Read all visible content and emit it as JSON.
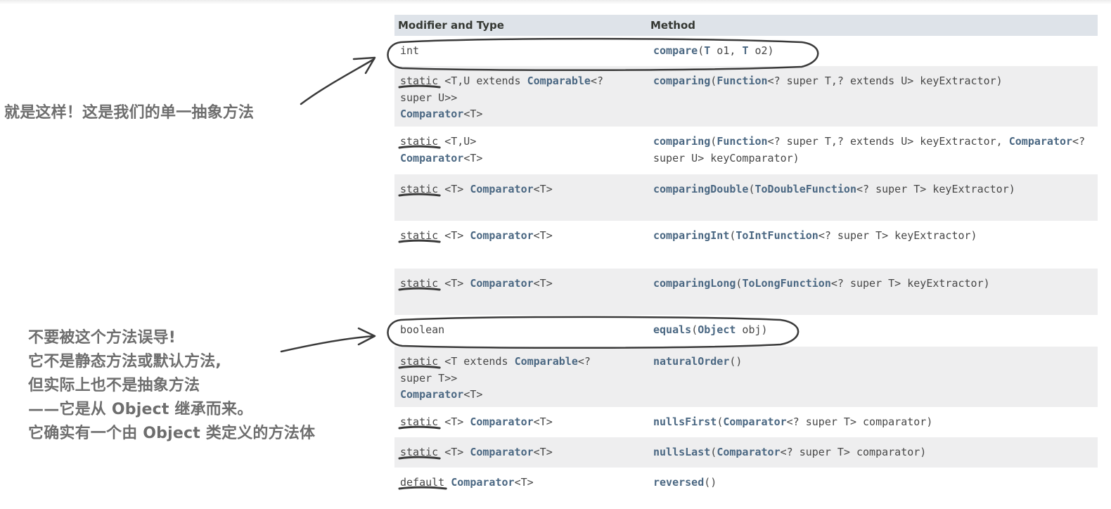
{
  "annotations": {
    "top_note": "就是这样！这是我们的单一抽象方法",
    "bottom_note_lines": [
      "不要被这个方法误导!",
      "它不是静态方法或默认方法,",
      "但实际上也不是抽象方法",
      "——它是从 Object 继承而来。",
      "它确实有一个由 Object 类定义的方法体"
    ]
  },
  "table": {
    "header": {
      "col1": "Modifier and Type",
      "col2": "Method"
    },
    "rows": [
      {
        "mod_lines": [
          [
            [
              "int",
              "t"
            ]
          ]
        ],
        "method_lines": [
          [
            [
              "compare",
              "m"
            ],
            [
              "(",
              "t"
            ],
            [
              "T",
              "l"
            ],
            [
              " o1, ",
              "t"
            ],
            [
              "T",
              "l"
            ],
            [
              " o2)",
              "t"
            ]
          ]
        ]
      },
      {
        "mod_lines": [
          [
            [
              "static",
              "t"
            ],
            [
              " <T,U extends ",
              "t"
            ],
            [
              "Comparable",
              "l"
            ],
            [
              "<?",
              "t"
            ]
          ],
          [
            [
              "super U>>",
              "t"
            ]
          ],
          [
            [
              "Comparator",
              "l"
            ],
            [
              "<T>",
              "t"
            ]
          ]
        ],
        "method_lines": [
          [
            [
              "comparing",
              "m"
            ],
            [
              "(",
              "t"
            ],
            [
              "Function",
              "l"
            ],
            [
              "<? super T,? extends U> keyExtractor)",
              "t"
            ]
          ]
        ]
      },
      {
        "mod_lines": [
          [
            [
              "static",
              "t"
            ],
            [
              " <T,U>",
              "t"
            ]
          ],
          [
            [
              "Comparator",
              "l"
            ],
            [
              "<T>",
              "t"
            ]
          ]
        ],
        "method_lines": [
          [
            [
              "comparing",
              "m"
            ],
            [
              "(",
              "t"
            ],
            [
              "Function",
              "l"
            ],
            [
              "<? super T,? extends U> keyExtractor, ",
              "t"
            ],
            [
              "Comparator",
              "l"
            ],
            [
              "<?",
              "t"
            ]
          ],
          [
            [
              "super U> keyComparator)",
              "t"
            ]
          ]
        ]
      },
      {
        "mod_lines": [
          [
            [
              "static",
              "t"
            ],
            [
              " <T> ",
              "t"
            ],
            [
              "Comparator",
              "l"
            ],
            [
              "<T>",
              "t"
            ]
          ]
        ],
        "method_lines": [
          [
            [
              "comparingDouble",
              "m"
            ],
            [
              "(",
              "t"
            ],
            [
              "ToDoubleFunction",
              "l"
            ],
            [
              "<? super T> keyExtractor)",
              "t"
            ]
          ]
        ]
      },
      {
        "mod_lines": [
          [
            [
              "static",
              "t"
            ],
            [
              " <T> ",
              "t"
            ],
            [
              "Comparator",
              "l"
            ],
            [
              "<T>",
              "t"
            ]
          ]
        ],
        "method_lines": [
          [
            [
              "comparingInt",
              "m"
            ],
            [
              "(",
              "t"
            ],
            [
              "ToIntFunction",
              "l"
            ],
            [
              "<? super T> keyExtractor)",
              "t"
            ]
          ]
        ]
      },
      {
        "mod_lines": [
          [
            [
              "static",
              "t"
            ],
            [
              " <T> ",
              "t"
            ],
            [
              "Comparator",
              "l"
            ],
            [
              "<T>",
              "t"
            ]
          ]
        ],
        "method_lines": [
          [
            [
              "comparingLong",
              "m"
            ],
            [
              "(",
              "t"
            ],
            [
              "ToLongFunction",
              "l"
            ],
            [
              "<? super T> keyExtractor)",
              "t"
            ]
          ]
        ]
      },
      {
        "mod_lines": [
          [
            [
              "boolean",
              "t"
            ]
          ]
        ],
        "method_lines": [
          [
            [
              "equals",
              "m"
            ],
            [
              "(",
              "t"
            ],
            [
              "Object",
              "l"
            ],
            [
              " obj)",
              "t"
            ]
          ]
        ]
      },
      {
        "mod_lines": [
          [
            [
              "static",
              "t"
            ],
            [
              " <T extends ",
              "t"
            ],
            [
              "Comparable",
              "l"
            ],
            [
              "<?",
              "t"
            ]
          ],
          [
            [
              "super T>>",
              "t"
            ]
          ],
          [
            [
              "Comparator",
              "l"
            ],
            [
              "<T>",
              "t"
            ]
          ]
        ],
        "method_lines": [
          [
            [
              "naturalOrder",
              "m"
            ],
            [
              "()",
              "t"
            ]
          ]
        ]
      },
      {
        "mod_lines": [
          [
            [
              "static",
              "t"
            ],
            [
              " <T> ",
              "t"
            ],
            [
              "Comparator",
              "l"
            ],
            [
              "<T>",
              "t"
            ]
          ]
        ],
        "method_lines": [
          [
            [
              "nullsFirst",
              "m"
            ],
            [
              "(",
              "t"
            ],
            [
              "Comparator",
              "l"
            ],
            [
              "<? super T> comparator)",
              "t"
            ]
          ]
        ]
      },
      {
        "mod_lines": [
          [
            [
              "static",
              "t"
            ],
            [
              " <T> ",
              "t"
            ],
            [
              "Comparator",
              "l"
            ],
            [
              "<T>",
              "t"
            ]
          ]
        ],
        "method_lines": [
          [
            [
              "nullsLast",
              "m"
            ],
            [
              "(",
              "t"
            ],
            [
              "Comparator",
              "l"
            ],
            [
              "<? super T> comparator)",
              "t"
            ]
          ]
        ]
      },
      {
        "mod_lines": [
          [
            [
              "default",
              "t"
            ],
            [
              " ",
              "t"
            ],
            [
              "Comparator",
              "l"
            ],
            [
              "<T>",
              "t"
            ]
          ]
        ],
        "method_lines": [
          [
            [
              "reversed",
              "m"
            ],
            [
              "()",
              "t"
            ]
          ]
        ]
      }
    ]
  },
  "colors": {
    "link": "#4a6782",
    "text": "#474747",
    "header_bg": "#dee3e9",
    "alt_row_bg": "#eeeeef",
    "annotation": "#6e6e6e",
    "ink": "#3a3a3a"
  }
}
